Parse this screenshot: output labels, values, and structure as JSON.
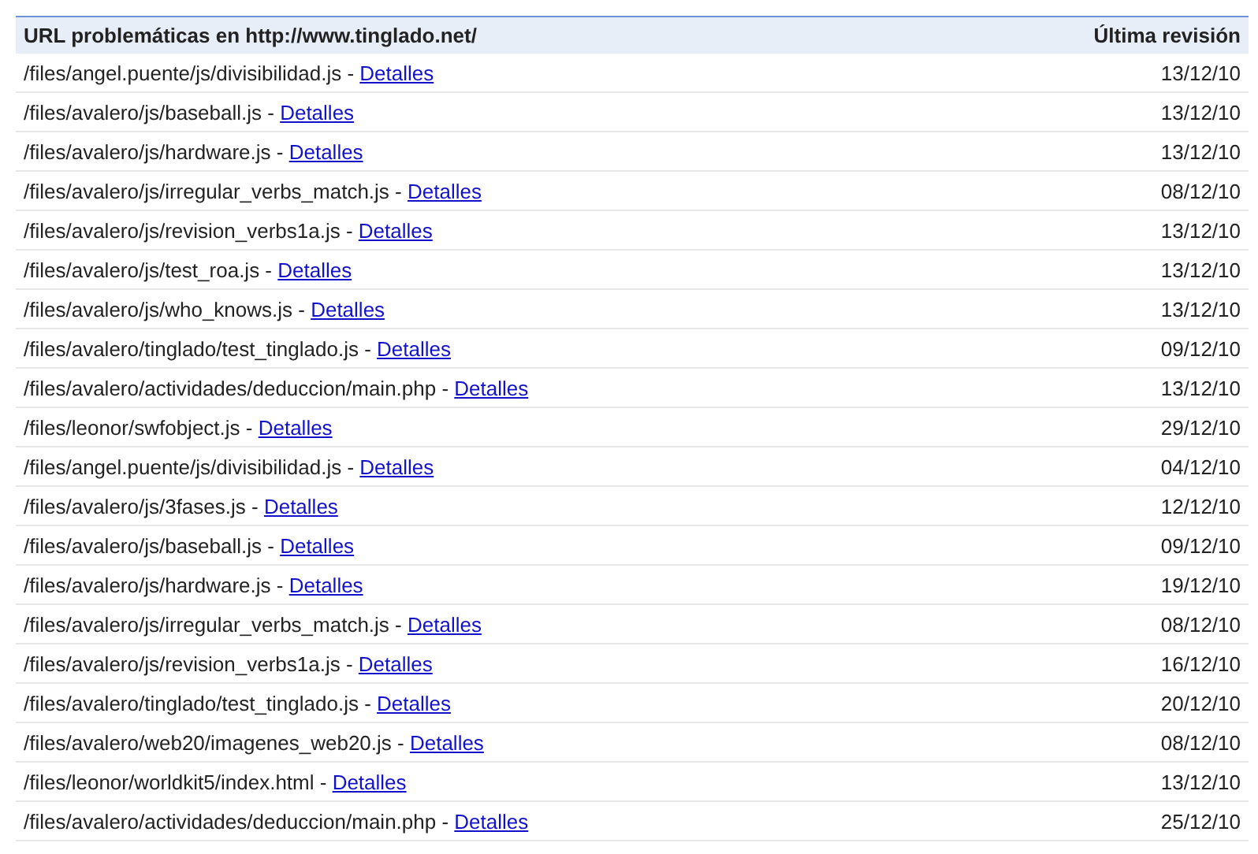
{
  "table": {
    "columns": [
      "URL problemáticas en http://www.tinglado.net/",
      "Última revisión"
    ],
    "rows": [
      {
        "url": "/files/angel.puente/js/divisibilidad.js -",
        "link": "Detalles",
        "date": "13/12/10"
      },
      {
        "url": "/files/avalero/js/baseball.js -",
        "link": "Detalles",
        "date": "13/12/10"
      },
      {
        "url": "/files/avalero/js/hardware.js -",
        "link": "Detalles",
        "date": "13/12/10"
      },
      {
        "url": "/files/avalero/js/irregular_verbs_match.js -",
        "link": "Detalles",
        "date": "08/12/10"
      },
      {
        "url": "/files/avalero/js/revision_verbs1a.js -",
        "link": "Detalles",
        "date": "13/12/10"
      },
      {
        "url": "/files/avalero/js/test_roa.js -",
        "link": "Detalles",
        "date": "13/12/10"
      },
      {
        "url": "/files/avalero/js/who_knows.js -",
        "link": "Detalles",
        "date": "13/12/10"
      },
      {
        "url": "/files/avalero/tinglado/test_tinglado.js -",
        "link": "Detalles",
        "date": "09/12/10"
      },
      {
        "url": "/files/avalero/actividades/deduccion/main.php -",
        "link": "Detalles",
        "date": "13/12/10"
      },
      {
        "url": "/files/leonor/swfobject.js -",
        "link": "Detalles",
        "date": "29/12/10"
      },
      {
        "url": "/files/angel.puente/js/divisibilidad.js -",
        "link": "Detalles",
        "date": "04/12/10"
      },
      {
        "url": "/files/avalero/js/3fases.js -",
        "link": "Detalles",
        "date": "12/12/10"
      },
      {
        "url": "/files/avalero/js/baseball.js -",
        "link": "Detalles",
        "date": "09/12/10"
      },
      {
        "url": "/files/avalero/js/hardware.js -",
        "link": "Detalles",
        "date": "19/12/10"
      },
      {
        "url": "/files/avalero/js/irregular_verbs_match.js -",
        "link": "Detalles",
        "date": "08/12/10"
      },
      {
        "url": "/files/avalero/js/revision_verbs1a.js -",
        "link": "Detalles",
        "date": "16/12/10"
      },
      {
        "url": "/files/avalero/tinglado/test_tinglado.js -",
        "link": "Detalles",
        "date": "20/12/10"
      },
      {
        "url": "/files/avalero/web20/imagenes_web20.js -",
        "link": "Detalles",
        "date": "08/12/10"
      },
      {
        "url": "/files/leonor/worldkit5/index.html -",
        "link": "Detalles",
        "date": "13/12/10"
      },
      {
        "url": "/files/avalero/actividades/deduccion/main.php -",
        "link": "Detalles",
        "date": "25/12/10"
      }
    ]
  }
}
